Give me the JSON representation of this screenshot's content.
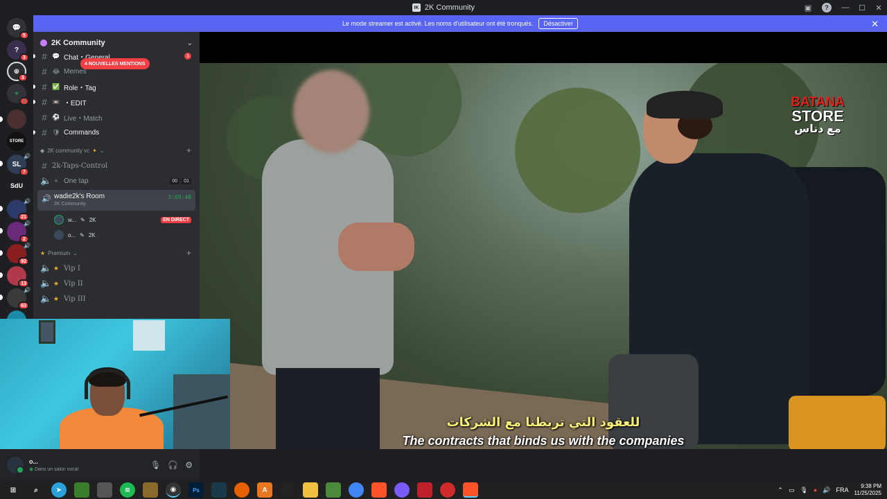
{
  "window": {
    "title": "2K Community"
  },
  "banner": {
    "message": "Le mode streamer est activé. Les noms d'utilisateur ont été tronqués.",
    "button": "Désactiver"
  },
  "rail": {
    "servers": [
      {
        "icon": "discord-home-icon",
        "badge": "5",
        "color": "#313338"
      },
      {
        "icon": "question-mark-icon",
        "badge": "3",
        "color": "#3a2f4f"
      },
      {
        "icon": "server-logo-icon",
        "badge": "3",
        "color": "#2b2d31"
      },
      {
        "icon": "add-server-icon",
        "badge": "1",
        "color": "#313338"
      },
      {
        "icon": "server-avatar-icon",
        "badge": "",
        "color": "#4a2f2f"
      },
      {
        "icon": "store-server-icon",
        "badge": "",
        "color": "#111",
        "label": "STORE"
      },
      {
        "icon": "server-avatar-icon",
        "badge": "7",
        "color": "#2f3e55"
      },
      {
        "icon": "sdu-server-icon",
        "badge": "",
        "color": "#1e1f22",
        "label": "SdU"
      },
      {
        "icon": "server-avatar-icon",
        "badge": "21",
        "color": "#2c3a6a"
      },
      {
        "icon": "server-avatar-icon",
        "badge": "2",
        "color": "#6a2a7a"
      },
      {
        "icon": "server-avatar-icon",
        "badge": "92",
        "color": "#8a1f1f"
      },
      {
        "icon": "server-avatar-icon",
        "badge": "13",
        "color": "#b03a4a"
      },
      {
        "icon": "server-avatar-icon",
        "badge": "63",
        "color": "#3a3a3a"
      },
      {
        "icon": "server-avatar-icon",
        "badge": "",
        "color": "#1a8aa8"
      }
    ]
  },
  "sidebar": {
    "guild_name": "2K Community",
    "mentions_pill": "4 NOUVELLES MENTIONS",
    "channels": [
      {
        "name": "Chat・General",
        "emoji": "💬",
        "badge": "3"
      },
      {
        "name": "Memes",
        "emoji": "😂",
        "badge": ""
      },
      {
        "name": "Role・Tag",
        "emoji": "✅",
        "badge": ""
      },
      {
        "name": "・EDIT",
        "emoji": "📼",
        "badge": ""
      },
      {
        "name": "Live・Match",
        "emoji": "⚽",
        "badge": ""
      },
      {
        "name": "Commands",
        "emoji": "🛡",
        "badge": ""
      }
    ],
    "voice_category": "2K community vc",
    "voice_channels": [
      {
        "name": "2k-Taps-Control"
      },
      {
        "name": "One tap",
        "counts": [
          "00",
          "01"
        ]
      }
    ],
    "room": {
      "name": "wadie2k's Room",
      "sub": "2K Community",
      "time": "3:09:48"
    },
    "members": [
      {
        "name": "w...",
        "tag": "2K",
        "live": "EN DIRECT"
      },
      {
        "name": "o...",
        "tag": "2K",
        "live": ""
      }
    ],
    "premium_category": "Premium",
    "premium_channels": [
      {
        "name": "Vip I"
      },
      {
        "name": "Vip II"
      },
      {
        "name": "Vip III"
      }
    ]
  },
  "user_panel": {
    "name": "o...",
    "status": "Dans un salon vocal"
  },
  "video": {
    "subtitle_ar": "للعقود التي تربطنا مع الشركات",
    "subtitle_en": "The contracts that binds us with the companies",
    "watermark": {
      "line1": "BATANA",
      "line2": "STORE",
      "line3": "مع دناس"
    }
  },
  "taskbar": {
    "icons": [
      "windows-start-icon",
      "search-icon",
      "telegram-icon",
      "app-icon",
      "app-icon",
      "spotify-icon",
      "app-icon",
      "obs-icon",
      "photoshop-icon",
      "app-icon",
      "firefox-icon",
      "app-icon",
      "app-icon",
      "file-explorer-icon",
      "app-icon",
      "chrome-icon",
      "brave-icon",
      "app-icon",
      "app-icon",
      "app-icon",
      "brave-icon"
    ],
    "lang": "FRA",
    "time": "9:38 PM",
    "date": "11/25/2025"
  },
  "colors": {
    "accent": "#5865f2",
    "danger": "#f23f43",
    "online": "#23a55a"
  }
}
